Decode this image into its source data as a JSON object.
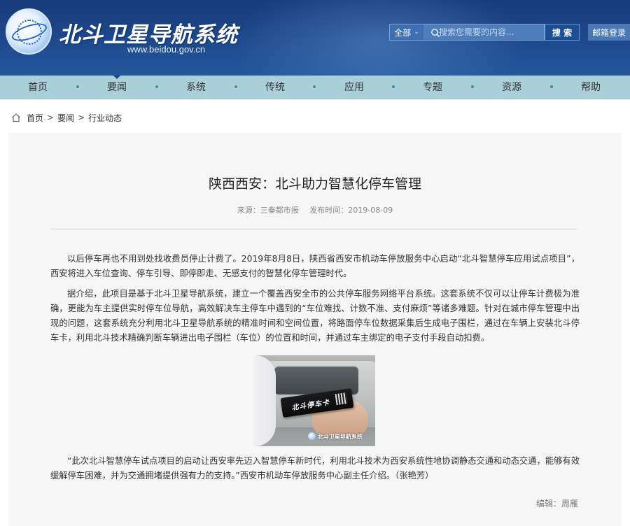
{
  "header": {
    "site_title": "北斗卫星导航系统",
    "url": "www.beidou.gov.cn",
    "search": {
      "scope_label": "全部",
      "placeholder": "搜索您需要的内容...",
      "button_label": "搜 索"
    },
    "mail_login_label": "邮箱登录"
  },
  "nav": {
    "items": [
      "首页",
      "要闻",
      "系统",
      "传统",
      "应用",
      "专题",
      "资源",
      "帮助"
    ],
    "active": "要闻"
  },
  "breadcrumb": [
    "首页",
    "要闻",
    "行业动态"
  ],
  "article": {
    "title": "陕西西安：北斗助力智慧化停车管理",
    "source": "来源：三秦都市报",
    "date": "发布时间：2019-08-09",
    "paragraphs": [
      "以后停车再也不用到处找收费员停止计费了。2019年8月8日，陕西省西安市机动车停放服务中心启动“北斗智慧停车应用试点项目”，西安将进入车位查询、停车引导、即停即走、无感支付的智慧化停车管理时代。",
      "据介绍，此项目是基于北斗卫星导航系统，建立一个覆盖西安全市的公共停车服务网络平台系统。这套系统不仅可以让停车计费极为准确，更能为车主提供实时停车位导航，高效解决车主停车中遇到的“车位难找、计数不准、支付麻烦”等诸多难题。针对在城市停车管理中出现的问题，这套系统充分利用北斗卫星导航系统的精准时间和空间位置，将路面停车位数据采集后生成电子围栏，通过在车辆上安装北斗停车卡，利用北斗技术精确判断车辆进出电子围栏（车位）的位置和时间，并通过车主绑定的电子支付手段自动扣费。",
      "“此次北斗智慧停车试点项目的启动让西安率先迈入智慧停车新时代，利用北斗技术为西安系统性地协调静态交通和动态交通，能够有效缓解停车困难，并为交通拥堵提供强有力的支持。”西安市机动车停放服务中心副主任介绍。（张艳芳）"
    ],
    "photo": {
      "card_label": "北斗停车卡",
      "watermark": "北斗卫星导航系统"
    },
    "editor": "编辑：周雁"
  },
  "colors": {
    "header_bg": "#1d4a8e",
    "nav_bg": "#a9cfd9",
    "content_bg": "#f6f6f6"
  }
}
